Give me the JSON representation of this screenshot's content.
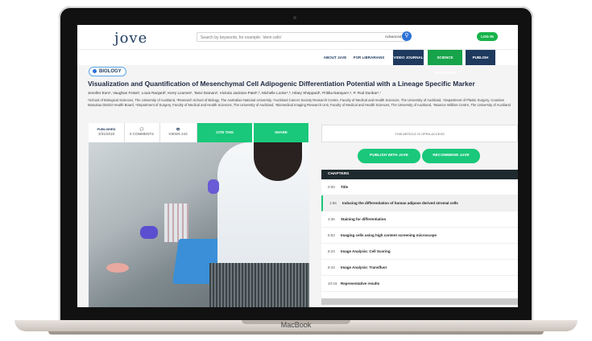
{
  "device": {
    "brand": "MacBook"
  },
  "header": {
    "logo": "jove",
    "search_placeholder": "Search by keywords, for example: 'stem cells'",
    "advanced": "Advanced",
    "search_icon": "search-icon",
    "login": "LOG IN"
  },
  "nav": {
    "items": [
      "ABOUT JoVE",
      "FOR LIBRARIANS",
      "VIDEO JOURNAL",
      "SCIENCE EDUCATION",
      "PUBLISH"
    ]
  },
  "article": {
    "section": "BIOLOGY",
    "title": "Visualization and Quantification of Mesenchymal Cell Adipogenic Differentiation Potential with a Lineage Specific Marker",
    "authors": "Jennifer Eom¹, Vaughan Feisst¹, Louis Ranjard², Kerry Loomes¹, Tanvi Damani¹, Victoria Jackson-Patel¹,³, Michelle Locke⁴,⁵, Hilary Sheppard¹, Pritika Narayan¹,⁶, P. Rod Dunbar¹,⁷",
    "affiliations": "¹School of Biological Sciences, The University of Auckland, ²Research School of Biology, The Australian National University, ³Auckland Cancer Society Research Centre, Faculty of Medical and Health Sciences, The University of Auckland, ⁴Department of Plastic Surgery, Counties Manukau District Health Board, ⁵Department of Surgery, Faculty of Medical and Health Sciences, The University of Auckland, ⁶Biomedical Imaging Research Unit, Faculty of Medical and Health Sciences, The University of Auckland, ⁷Maurice Wilkins Centre, The University of Auckland"
  },
  "stats": {
    "published_label": "PUBLISHED",
    "published_date": "3/31/2018",
    "comments_count": "0",
    "comments_label": "0 COMMENTS",
    "views_label": "VIEWS 243",
    "cite": "CITE THIS",
    "share": "SHARE"
  },
  "access_notice": "THIS ARTICLE IS OPEN ACCESS",
  "actions": {
    "publish": "PUBLISH WITH JoVE",
    "recommend": "RECOMMEND JoVE"
  },
  "chapters": {
    "heading": "CHAPTERS",
    "items": [
      {
        "time": "0:00",
        "label": "Title"
      },
      {
        "time": "1:56",
        "label": "Inducing the differentiation of human adipose derived stromal cells"
      },
      {
        "time": "3:36",
        "label": "Staining for differentiation"
      },
      {
        "time": "5:53",
        "label": "Imaging cells using high content screening microscope"
      },
      {
        "time": "8:23",
        "label": "Image Analysis: Cell Scoring"
      },
      {
        "time": "8:43",
        "label": "Image Analysis: Transfluor"
      },
      {
        "time": "10:43",
        "label": "Representative results"
      }
    ]
  }
}
